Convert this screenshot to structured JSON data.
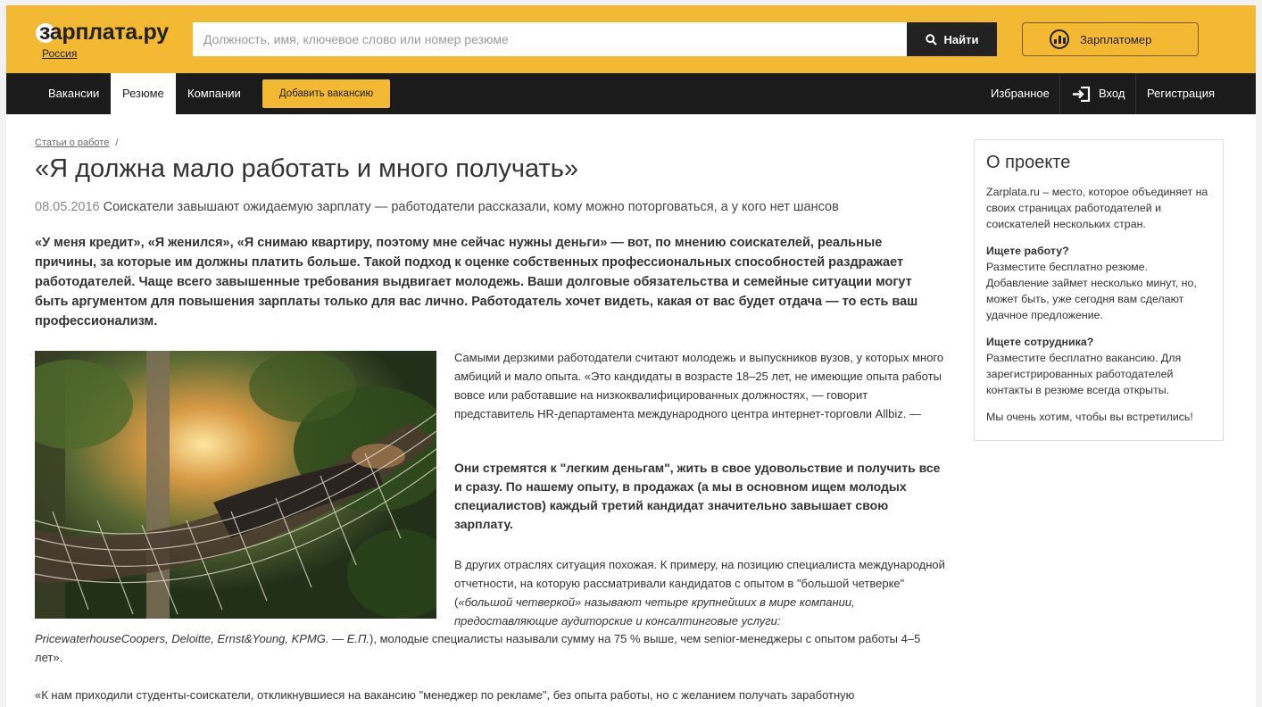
{
  "header": {
    "logo": "зарплата.ру",
    "region": "Россия",
    "search_placeholder": "Должность, имя, ключевое слово или номер резюме",
    "search_button": "Найти",
    "salary_button": "Зарплатомер"
  },
  "nav": {
    "items": [
      "Вакансии",
      "Резюме",
      "Компании"
    ],
    "active": "Резюме",
    "add_vacancy": "Добавить вакансию",
    "favorites": "Избранное",
    "login": "Вход",
    "register": "Регистрация"
  },
  "article": {
    "breadcrumb": "Статьи о работе",
    "breadcrumb_sep": "/",
    "title": "«Я должна мало работать и много получать»",
    "date": "08.05.2016",
    "subtitle": "Соискатели завышают ожидаемую зарплату — работодатели рассказали, кому можно поторговаться, а у кого нет шансов",
    "lead": "«У меня кредит», «Я женился», «Я снимаю квартиру, поэтому мне сейчас нужны деньги» — вот, по мнению соискателей, реальные причины, за которые им должны платить больше. Такой подход к оценке собственных профессиональных способностей раздражает работодателей. Чаще всего завышенные требования выдвигает молодежь. Ваши долговые обязательства и семейные ситуации могут быть аргументом для повышения зарплаты только для вас лично. Работодатель хочет видеть, какая от вас будет отдача — то есть ваш профессионализм.",
    "p1": "Самыми дерзкими работодатели считают молодежь и выпускников вузов, у которых много амбиций и мало опыта. «Это кандидаты в возрасте 18–25 лет, не имеющие опыта работы вовсе или работавшие на низкоквалифицированных должностях, — говорит представитель HR-департамента международного центра интернет-торговли Allbiz. —",
    "p2": "Они стремятся к \"легким деньгам\", жить в свое удовольствие и получить все и сразу. По нашему опыту, в продажах (а мы в основном ищем молодых специалистов) каждый третий кандидат значительно завышает свою зарплату.",
    "p3a": "В других отраслях ситуация похожая. К примеру, на позицию специалиста международной отчетности, на которую рассматривали кандидатов с опытом в \"большой четверке\" (",
    "p3b": "«большой четверкой» называют четыре крупнейших в мире компании, предоставляющие аудиторские и консалтинговые услуги:",
    "p4a": "PricewaterhouseCoopers, Deloitte, Ernst&Young, KPMG. — Е.П.",
    "p4b": "), молодые специалисты называли сумму на 75 % выше, чем senior-менеджеры с опытом работы 4–5 лет».",
    "p5": "«К нам приходили студенты-соискатели, откликнувшиеся на вакансию \"менеджер по рекламе\", без опыта работы, но с желанием получать заработную"
  },
  "sidebar": {
    "title": "О проекте",
    "intro": "Zarplata.ru – место, которое объединяет на своих страницах работодателей и соискателей нескольких стран.",
    "job_heading": "Ищете работу?",
    "job_text": "Разместите бесплатно резюме. Добавление займет несколько минут, но, может быть, уже сегодня вам сделают удачное предложение.",
    "emp_heading": "Ищете сотрудника?",
    "emp_text": "Разместите бесплатно вакансию. Для зарегистрированных работодателей контакты в резюме всегда открыты.",
    "outro": "Мы очень хотим, чтобы вы встретились!"
  },
  "colors": {
    "brand_yellow": "#f4b932",
    "nav_dark": "#1b1b1b"
  },
  "icons": {
    "search": "search-icon",
    "salary": "gauge-icon",
    "login": "login-icon"
  }
}
